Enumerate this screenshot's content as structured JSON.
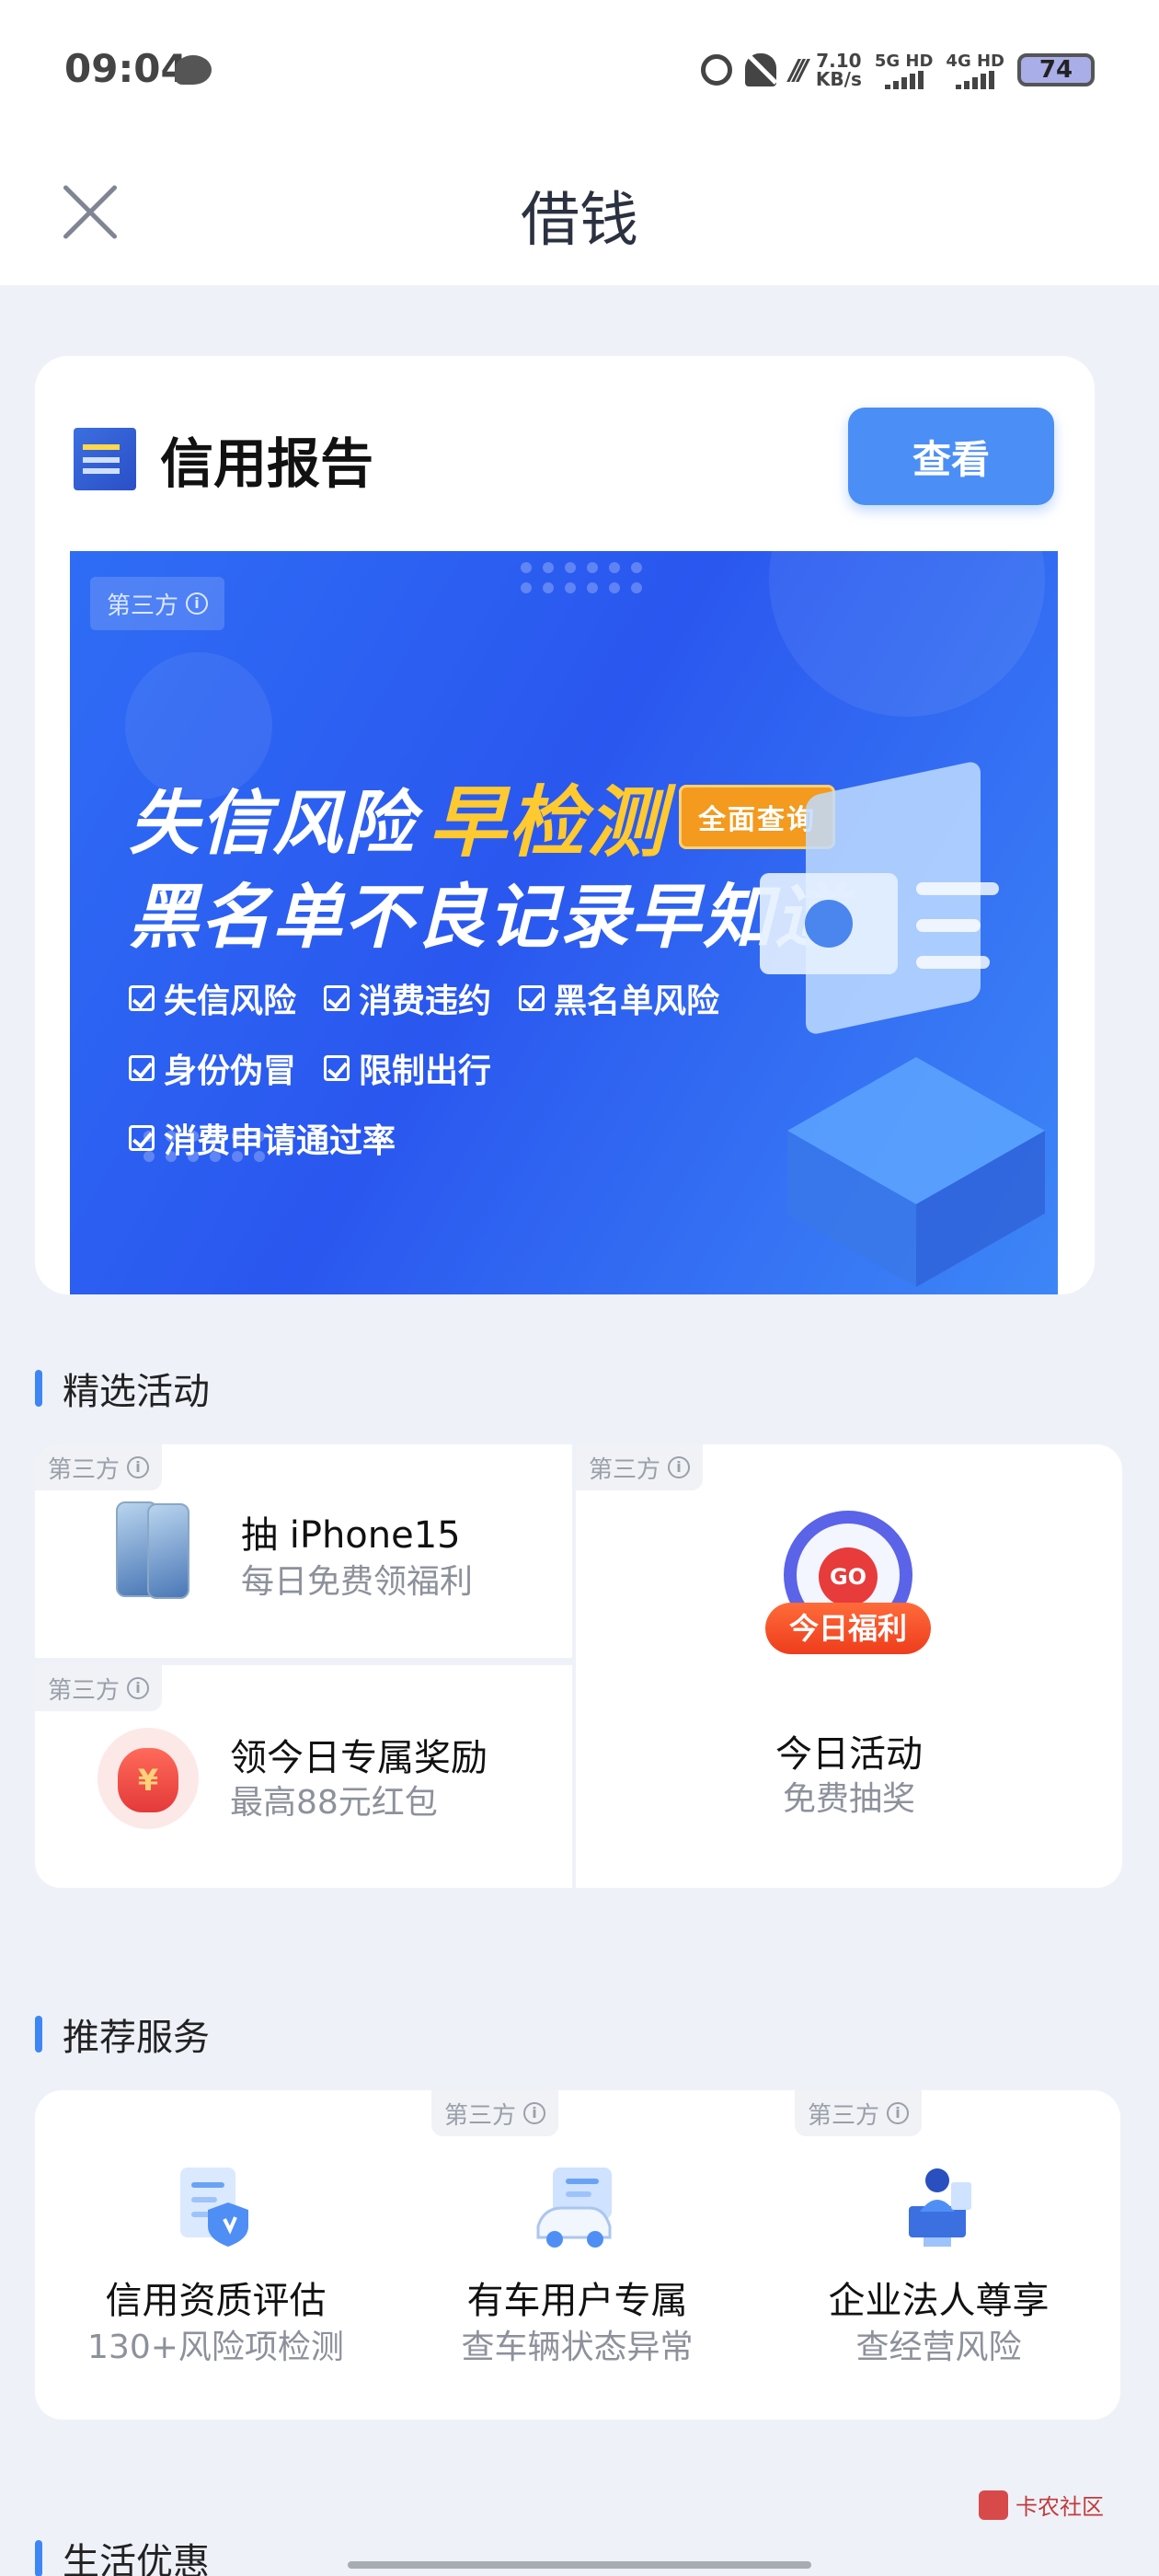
{
  "status_bar": {
    "time": "09:04",
    "net_speed_value": "7.10",
    "net_speed_unit": "KB/s",
    "sim1_label": "5G HD",
    "sim2_label": "4G HD",
    "battery": "74"
  },
  "header": {
    "title": "借钱"
  },
  "credit_report": {
    "title": "信用报告",
    "view_button": "查看",
    "banner": {
      "third_party_tag": "第三方",
      "headline_part1": "失信风险",
      "headline_accent": "早检测",
      "full_query_badge": "全面查询",
      "headline2": "黑名单不良记录早知道",
      "checks": [
        "失信风险",
        "消费违约",
        "黑名单风险",
        "身份伪冒",
        "限制出行",
        "消费申请通过率"
      ]
    }
  },
  "featured": {
    "section_title": "精选活动",
    "third_party_tag": "第三方",
    "items": [
      {
        "title": "抽 iPhone15",
        "subtitle": "每日免费领福利"
      },
      {
        "title": "领今日专属奖励",
        "subtitle": "最高88元红包"
      },
      {
        "title": "今日活动",
        "subtitle": "免费抽奖",
        "badge": "今日福利",
        "go": "GO"
      }
    ],
    "money_symbol": "¥"
  },
  "services": {
    "section_title": "推荐服务",
    "third_party_tag": "第三方",
    "items": [
      {
        "title": "信用资质评估",
        "subtitle": "130+风险项检测"
      },
      {
        "title": "有车用户专属",
        "subtitle": "查车辆状态异常"
      },
      {
        "title": "企业法人尊享",
        "subtitle": "查经营风险"
      }
    ]
  },
  "life": {
    "section_title": "生活优惠"
  },
  "watermark": "卡农社区",
  "colors": {
    "accent": "#4b8ef5",
    "banner_blue": "#2f6df5",
    "section_bar": "#3e86f3",
    "highlight_yellow": "#ffc930"
  }
}
